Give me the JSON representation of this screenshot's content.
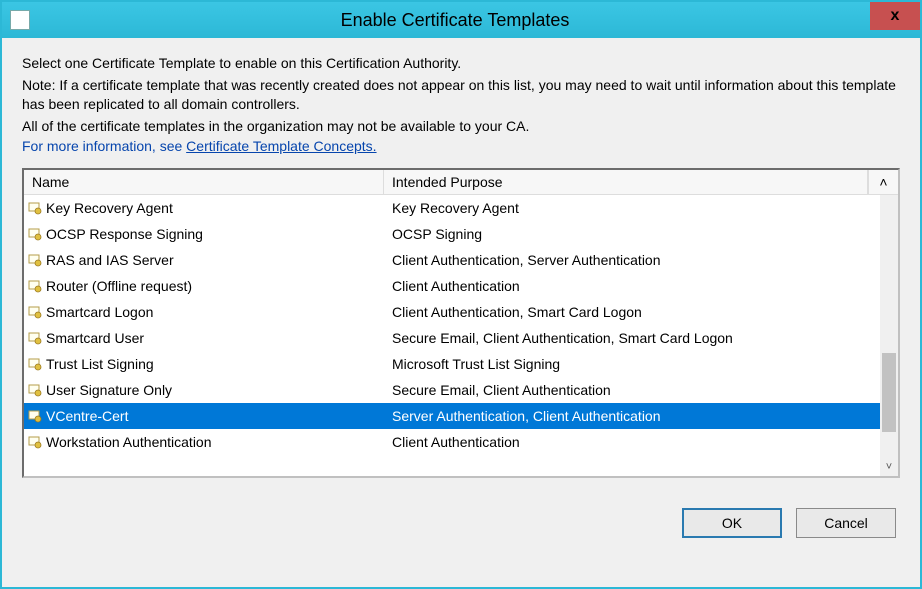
{
  "window": {
    "title": "Enable Certificate Templates"
  },
  "instructions": {
    "line1": "Select one Certificate Template to enable on this Certification Authority.",
    "line2": "Note: If a certificate template that was recently created does not appear on this list, you may need to wait until information about this template has been replicated to all domain controllers.",
    "line3": "All of the certificate templates in the organization may not be available to your CA."
  },
  "more_info": {
    "prefix": "For more information, see ",
    "link_text": "Certificate Template Concepts."
  },
  "columns": {
    "name": "Name",
    "purpose": "Intended Purpose"
  },
  "rows": [
    {
      "name": "Key Recovery Agent",
      "purpose": "Key Recovery Agent",
      "selected": false
    },
    {
      "name": "OCSP Response Signing",
      "purpose": "OCSP Signing",
      "selected": false
    },
    {
      "name": "RAS and IAS Server",
      "purpose": "Client Authentication, Server Authentication",
      "selected": false
    },
    {
      "name": "Router (Offline request)",
      "purpose": "Client Authentication",
      "selected": false
    },
    {
      "name": "Smartcard Logon",
      "purpose": "Client Authentication, Smart Card Logon",
      "selected": false
    },
    {
      "name": "Smartcard User",
      "purpose": "Secure Email, Client Authentication, Smart Card Logon",
      "selected": false
    },
    {
      "name": "Trust List Signing",
      "purpose": "Microsoft Trust List Signing",
      "selected": false
    },
    {
      "name": "User Signature Only",
      "purpose": "Secure Email, Client Authentication",
      "selected": false
    },
    {
      "name": "VCentre-Cert",
      "purpose": "Server Authentication, Client Authentication",
      "selected": true
    },
    {
      "name": "Workstation Authentication",
      "purpose": "Client Authentication",
      "selected": false
    }
  ],
  "buttons": {
    "ok": "OK",
    "cancel": "Cancel"
  },
  "glyphs": {
    "up": "˄",
    "down": "˅",
    "close": "x"
  }
}
